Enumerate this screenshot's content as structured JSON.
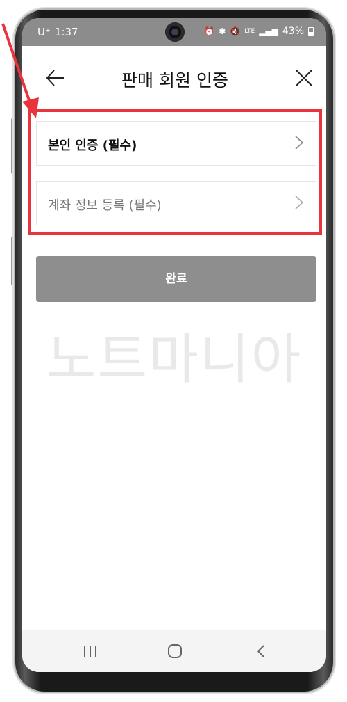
{
  "status_bar": {
    "carrier": "U⁺",
    "time": "1:37",
    "battery_percent": "43%",
    "network": "LTE"
  },
  "header": {
    "title": "판매 회원 인증"
  },
  "menu": {
    "items": [
      {
        "label": "본인 인증 (필수)"
      },
      {
        "label": "계좌 정보 등록 (필수)"
      }
    ]
  },
  "complete_button": {
    "label": "완료"
  },
  "watermark": {
    "text": "노트마니아"
  },
  "colors": {
    "highlight": "#e8343c",
    "button": "#8e8e8e",
    "status_bar": "#8c8c8c"
  }
}
